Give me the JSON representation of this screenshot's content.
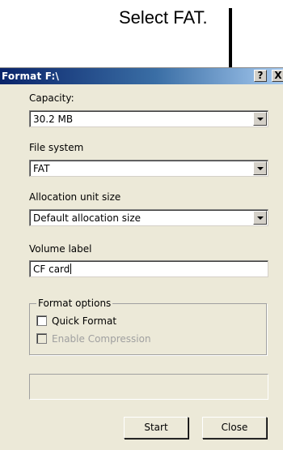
{
  "callout": {
    "text": "Select FAT."
  },
  "dialog": {
    "title": "Format F:\\",
    "help_glyph": "?",
    "close_glyph": "X",
    "capacity": {
      "label": "Capacity:",
      "value": "30.2 MB"
    },
    "file_system": {
      "label": "File system",
      "value": "FAT"
    },
    "allocation": {
      "label": "Allocation unit size",
      "value": "Default allocation size"
    },
    "volume": {
      "label": "Volume label",
      "value": "CF card"
    },
    "format_options": {
      "legend": "Format options",
      "quick_format": {
        "label": "Quick Format",
        "checked": false
      },
      "enable_compression": {
        "label": "Enable Compression",
        "checked": false,
        "disabled": true
      }
    },
    "buttons": {
      "start": "Start",
      "close": "Close"
    }
  },
  "colors": {
    "titlebar_start": "#0a246a",
    "titlebar_end": "#a6caf0",
    "dialog_bg": "#ece9d8"
  },
  "icons": [
    "dropdown-arrow-icon",
    "help-icon",
    "close-icon"
  ]
}
